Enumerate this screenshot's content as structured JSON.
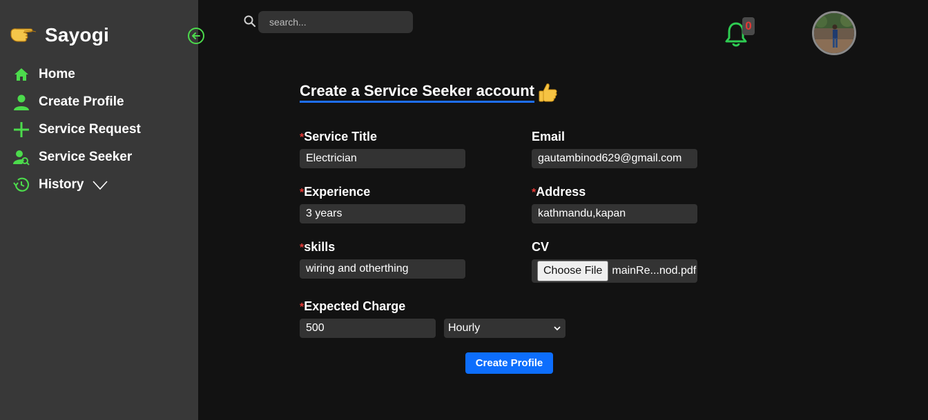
{
  "brand": {
    "name": "Sayogi"
  },
  "sidebar": {
    "items": [
      {
        "label": "Home",
        "icon": "home-icon"
      },
      {
        "label": "Create Profile",
        "icon": "user-icon"
      },
      {
        "label": "Service Request",
        "icon": "plus-icon"
      },
      {
        "label": "Service Seeker",
        "icon": "user-search-icon"
      },
      {
        "label": "History",
        "icon": "history-icon"
      }
    ]
  },
  "search": {
    "placeholder": "search..."
  },
  "notifications": {
    "count": "0"
  },
  "form": {
    "title": "Create a Service Seeker account",
    "fields": {
      "service_title": {
        "label": "Service Title",
        "required_mark": "*",
        "value": "Electrician"
      },
      "email": {
        "label": "Email",
        "value": "gautambinod629@gmail.com"
      },
      "experience": {
        "label": "Experience",
        "required_mark": "*",
        "value": "3 years"
      },
      "address": {
        "label": "Address",
        "required_mark": "*",
        "value": "kathmandu,kapan"
      },
      "skills": {
        "label": "skills",
        "required_mark": "*",
        "value": "wiring and otherthing"
      },
      "cv": {
        "label": "CV",
        "button_label": "Choose File",
        "file_name": "mainRe...nod.pdf"
      },
      "expected_charge": {
        "label": "Expected Charge",
        "required_mark": "*",
        "value": "500",
        "rate_selected": "Hourly"
      }
    },
    "submit_label": "Create Profile"
  },
  "colors": {
    "accent_green": "#4cdb4c",
    "accent_blue": "#0d6efd",
    "required_red": "#e53935",
    "sidebar_bg": "#383838",
    "page_bg": "#121212"
  }
}
